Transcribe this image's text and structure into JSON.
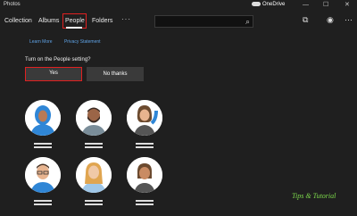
{
  "app": {
    "title": "Photos",
    "onedrive_label": "OneDrive"
  },
  "window_controls": {
    "minimize": "—",
    "maximize": "☐",
    "close": "✕"
  },
  "nav": {
    "tabs": [
      {
        "label": "Collection"
      },
      {
        "label": "Albums"
      },
      {
        "label": "People"
      },
      {
        "label": "Folders"
      }
    ],
    "more": "···"
  },
  "search": {
    "placeholder": ""
  },
  "links": {
    "learn_more": "Learn More",
    "privacy": "Privacy Statement"
  },
  "people_prompt": {
    "question": "Turn on the People setting?",
    "yes": "Yes",
    "no": "No thanks"
  },
  "watermark": "Tips & Tutorial",
  "colors": {
    "accent_red": "#e02020",
    "link_blue": "#5fa3e6",
    "skin": "#e8b48f",
    "hoodie_blue": "#2f86d6"
  }
}
